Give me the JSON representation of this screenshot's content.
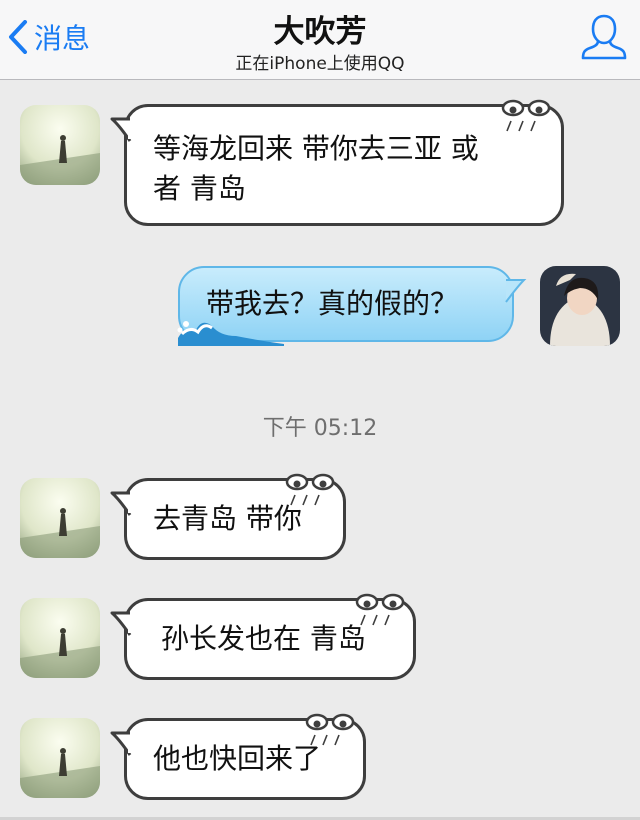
{
  "header": {
    "back_label": "消息",
    "title": "大吹芳",
    "subtitle": "正在iPhone上使用QQ",
    "accent_color": "#1a7cf3",
    "back_icon": "chevron-left-icon",
    "profile_icon": "person-outline-icon"
  },
  "messages": [
    {
      "direction": "incoming",
      "sender": "contact",
      "lines": [
        "等海龙回来  带你去三亚 或",
        "者 青岛"
      ]
    },
    {
      "direction": "outgoing",
      "sender": "self",
      "lines": [
        "带我去？真的假的？"
      ]
    },
    {
      "direction": "incoming",
      "sender": "contact",
      "lines": [
        "去青岛 带你"
      ]
    },
    {
      "direction": "incoming",
      "sender": "contact",
      "lines": [
        "孙长发也在 青岛"
      ]
    },
    {
      "direction": "incoming",
      "sender": "contact",
      "lines": [
        "他也快回来了"
      ]
    }
  ],
  "timestamp": "下午 05:12",
  "colors": {
    "background": "#ebebeb",
    "incoming_bubble": "#ffffff",
    "incoming_border": "#3e3e3e",
    "outgoing_bubble": "#9fd9f7"
  }
}
